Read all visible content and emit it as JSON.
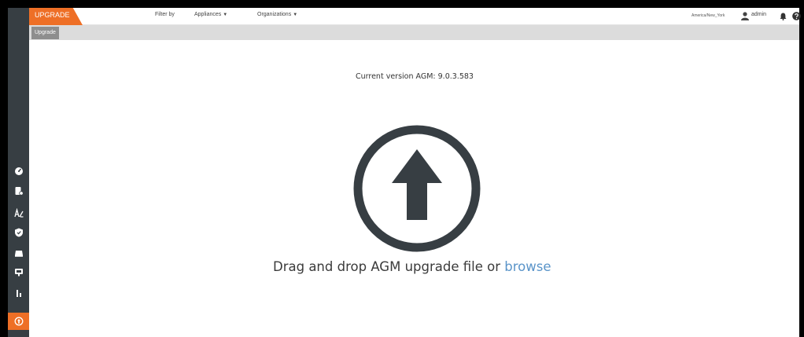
{
  "topbar": {
    "module_label": "UPGRADE",
    "filter_label": "Filter by",
    "filters": [
      {
        "label": "Appliances"
      },
      {
        "label": "Organizations"
      }
    ],
    "timezone": "America/New_York",
    "user_name": "admin"
  },
  "subnav": {
    "tab_label": "Upgrade"
  },
  "main": {
    "version_text": "Current version AGM: 9.0.3.583",
    "drop_text": "Drag and drop AGM upgrade file or",
    "browse_label": "browse"
  },
  "sidebar": {
    "items": [
      {
        "icon": "dashboard-icon"
      },
      {
        "icon": "app-manager-icon"
      },
      {
        "icon": "sla-architect-icon"
      },
      {
        "icon": "shield-icon"
      },
      {
        "icon": "backup-icon"
      },
      {
        "icon": "monitor-icon"
      },
      {
        "icon": "report-icon"
      },
      {
        "icon": "upgrade-icon",
        "active": true
      }
    ]
  },
  "colors": {
    "accent": "#ee6f26",
    "sidebar_bg": "#373e43",
    "icon_dark": "#373e43",
    "link": "#5a94c9"
  }
}
